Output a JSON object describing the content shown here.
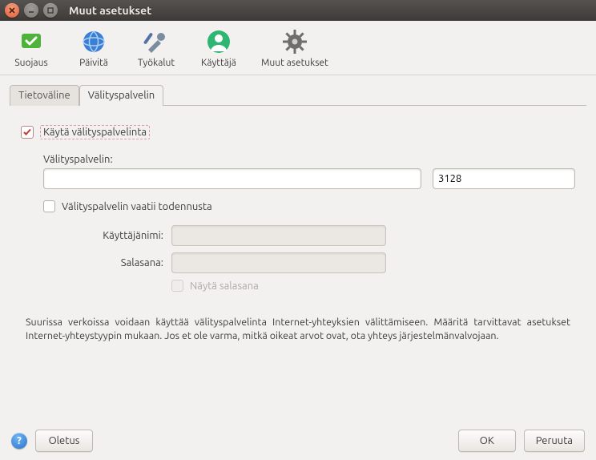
{
  "window": {
    "title": "Muut asetukset"
  },
  "toolbar": {
    "items": [
      {
        "label": "Suojaus"
      },
      {
        "label": "Päivitä"
      },
      {
        "label": "Työkalut"
      },
      {
        "label": "Käyttäjä"
      },
      {
        "label": "Muut asetukset"
      }
    ]
  },
  "tabs": {
    "items": [
      {
        "label": "Tietoväline"
      },
      {
        "label": "Välityspalvelin"
      }
    ],
    "active_index": 1
  },
  "proxy": {
    "use_proxy_label": "Käytä välityspalvelinta",
    "use_proxy_checked": true,
    "host_label": "Välityspalvelin:",
    "host_value": "",
    "port_value": "3128",
    "auth_required_label": "Välityspalvelin vaatii todennusta",
    "auth_required_checked": false,
    "username_label": "Käyttäjänimi:",
    "username_value": "",
    "password_label": "Salasana:",
    "password_value": "",
    "show_password_label": "Näytä salasana",
    "show_password_checked": false
  },
  "info_text": "Suurissa verkoissa voidaan käyttää välityspalvelinta Internet-yhteyksien välittämiseen. Määritä tarvittavat asetukset Internet-yhteystyypin mukaan. Jos et ole varma, mitkä oikeat arvot ovat, ota yhteys järjestelmänvalvojaan.",
  "footer": {
    "defaults_label": "Oletus",
    "ok_label": "OK",
    "cancel_label": "Peruuta"
  }
}
